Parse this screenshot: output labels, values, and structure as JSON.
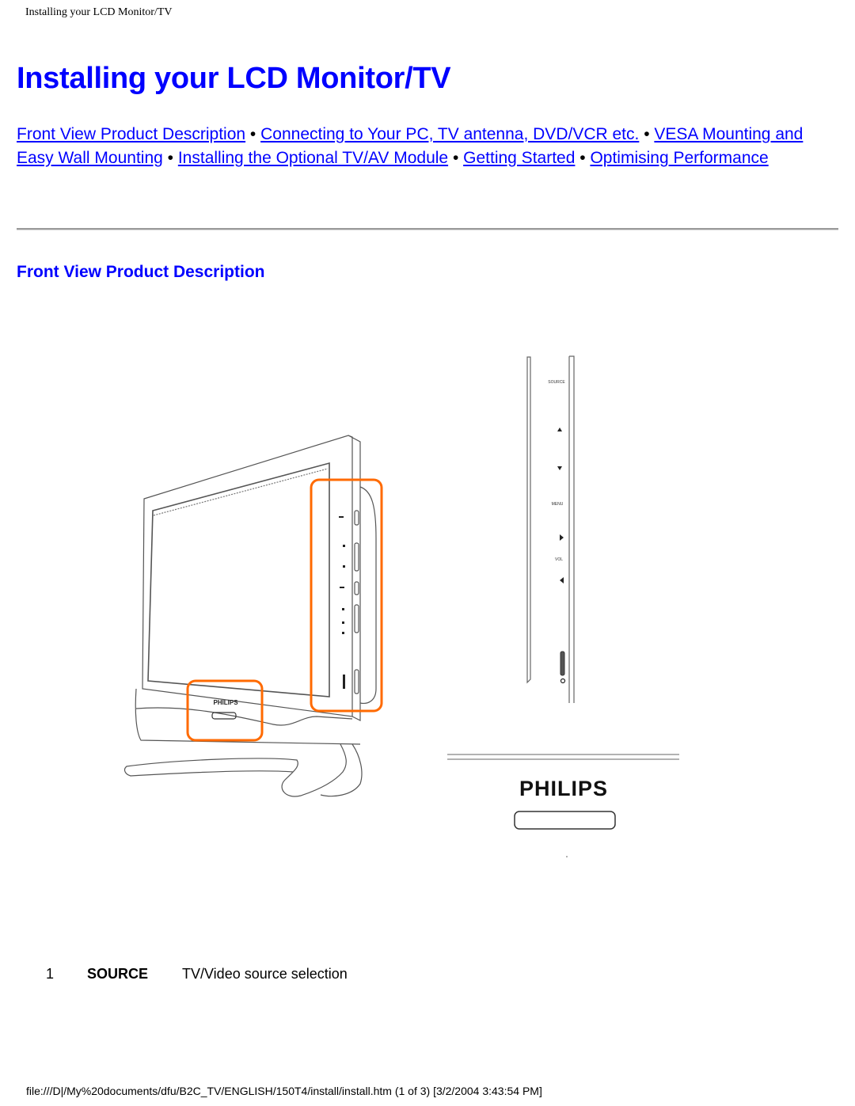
{
  "running_head": "Installing your LCD Monitor/TV",
  "page_title": "Installing your LCD Monitor/TV",
  "nav": {
    "separator": "•",
    "links": [
      {
        "label": "Front View Product Description"
      },
      {
        "label": "Connecting to Your PC, TV antenna, DVD/VCR etc."
      },
      {
        "label": "VESA Mounting and Easy Wall Mounting"
      },
      {
        "label": "Installing the Optional TV/AV Module"
      },
      {
        "label": "Getting Started"
      },
      {
        "label": "Optimising Performance"
      }
    ]
  },
  "section": {
    "title": "Front View Product Description"
  },
  "figure": {
    "monitor_brand": "PHILIPS",
    "side_panel_labels": {
      "source": "SOURCE",
      "menu": "MENU",
      "vol": "VOL"
    },
    "zoom_brand": "PHILIPS",
    "highlight_color": "#ff6a00"
  },
  "legend": [
    {
      "num": "1",
      "key": "SOURCE",
      "desc": "TV/Video source selection"
    }
  ],
  "footer": "file:///D|/My%20documents/dfu/B2C_TV/ENGLISH/150T4/install/install.htm (1 of 3) [3/2/2004 3:43:54 PM]"
}
